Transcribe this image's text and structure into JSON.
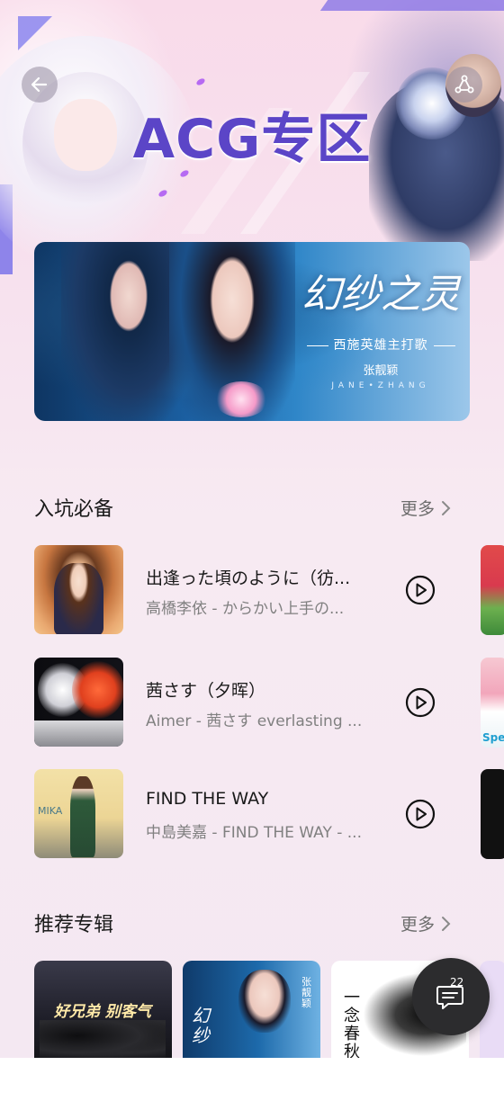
{
  "hero": {
    "title": "ACG专区",
    "back_icon": "arrow-left-icon",
    "share_icon": "share-icon"
  },
  "banner": {
    "title": "幻纱之灵",
    "subtitle": "西施英雄主打歌",
    "artist": "张靓颖",
    "artist_latin": "JANE•ZHANG"
  },
  "section_essentials": {
    "title": "入坑必备",
    "more": "更多",
    "songs": [
      {
        "title": "出逢った頃のように（彷...",
        "subtitle": "高橋李依 - からかい上手の..."
      },
      {
        "title": "茜さす（夕晖）",
        "subtitle": "Aimer - 茜さす everlasting ..."
      },
      {
        "title": "FIND THE WAY",
        "subtitle": "中島美嘉 - FIND THE WAY - ..."
      }
    ],
    "peek_labels": [
      "Spe"
    ]
  },
  "section_albums": {
    "title": "推荐专辑",
    "more": "更多",
    "album_texts": [
      "好兄弟 别客气",
      "幻纱",
      "张靓颖",
      "一念春秋"
    ]
  },
  "cover_texts": {
    "mika": "MIKA"
  },
  "fab": {
    "icon": "comment-icon",
    "count": "22"
  },
  "colors": {
    "accent": "#5b45c7",
    "background": "#f7e8f1"
  }
}
